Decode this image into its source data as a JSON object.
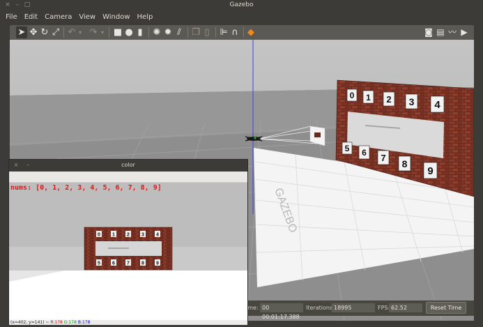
{
  "window": {
    "title": "Gazebo",
    "controls": [
      "×",
      "–",
      "□"
    ]
  },
  "menubar": {
    "items": [
      "File",
      "Edit",
      "Camera",
      "View",
      "Window",
      "Help"
    ]
  },
  "toolbar": {
    "left_icons": [
      "select-arrow-icon",
      "translate-icon",
      "rotate-icon",
      "scale-icon",
      "undo-icon",
      "redo-icon",
      "box-icon",
      "sphere-icon",
      "cylinder-icon",
      "point-light-icon",
      "spot-light-icon",
      "directional-light-icon",
      "copy-icon",
      "paste-icon",
      "align-icon",
      "snap-icon",
      "orange-joint-icon"
    ],
    "right_icons": [
      "camera-screenshot-icon",
      "log-icon",
      "plot-icon",
      "video-icon"
    ]
  },
  "scene": {
    "wall_digits_top": [
      "0",
      "1",
      "2",
      "3",
      "4"
    ],
    "wall_digits_bottom": [
      "5",
      "6",
      "7",
      "8",
      "9"
    ]
  },
  "statusbar": {
    "sim_time_label": "ime:",
    "sim_time_value": "00 00:01:17.388",
    "iterations_label": "Iterations:",
    "iterations_value": "18995",
    "fps_label": "FPS:",
    "fps_value": "62.52",
    "reset_label": "Reset Time"
  },
  "cv_window": {
    "title": "color",
    "controls": [
      "×",
      "–"
    ],
    "overlay_text": "nums: [0, 1, 2, 3, 4, 5, 6, 7, 8, 9]",
    "status_prefix": "(x=402, y=141) ~ ",
    "status_r": "R:178",
    "status_g": "G:178",
    "status_b": "B:178",
    "wall_digits_top": [
      "0",
      "1",
      "2",
      "3",
      "4"
    ],
    "wall_digits_bottom": [
      "5",
      "6",
      "7",
      "8",
      "9"
    ]
  }
}
